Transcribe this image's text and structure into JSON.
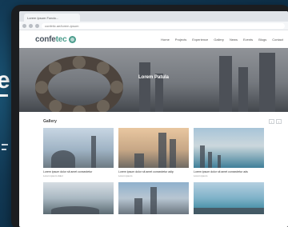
{
  "side": {
    "big_text": "e"
  },
  "browser": {
    "tab_title": "Lorem Ipsum Fondo...",
    "url": "confetic.ae/lorem-ipsum"
  },
  "site": {
    "logo_main": "confe",
    "logo_accent": "tec",
    "menu": [
      "Home",
      "Projects",
      "Experience",
      "Gallery",
      "News",
      "Events",
      "Blogs",
      "Contact"
    ]
  },
  "hero": {
    "title": "Lorem Patula"
  },
  "section": {
    "title": "Gallery",
    "prev_label": "‹",
    "next_label": "›",
    "cards": [
      {
        "caption": "Lorem ipsum dolor sit amet consectetur",
        "sub": "Lorem ipsum dolor"
      },
      {
        "caption": "Lorem ipsum dolor sit amet consectetur adip",
        "sub": "Lorem ipsum"
      },
      {
        "caption": "Lorem ipsum dolor sit amet consectetur ads",
        "sub": "Lorem ipsum"
      }
    ]
  },
  "colors": {
    "brand_accent": "#4d9e8e",
    "background": "#0e3550"
  }
}
